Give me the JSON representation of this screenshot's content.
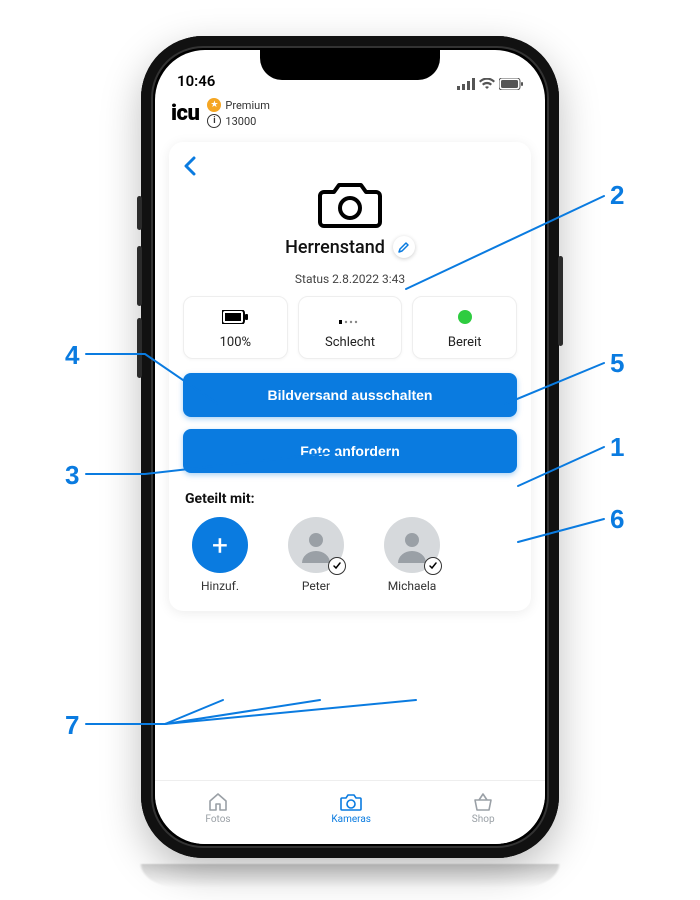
{
  "status_bar": {
    "time": "10:46"
  },
  "header": {
    "logo": "icu",
    "premium_label": "Premium",
    "points": "13000"
  },
  "camera": {
    "name": "Herrenstand",
    "status_line": "Status 2.8.2022 3:43",
    "tiles": {
      "battery": "100%",
      "signal": "Schlecht",
      "ready": "Bereit"
    },
    "btn_disable": "Bildversand ausschalten",
    "btn_request": "Foto anfordern",
    "shared_title": "Geteilt mit:",
    "shared": {
      "add": "Hinzuf.",
      "u1": "Peter",
      "u2": "Michaela"
    }
  },
  "tabs": {
    "photos": "Fotos",
    "cameras": "Kameras",
    "shop": "Shop"
  },
  "callouts": {
    "c1": "1",
    "c2": "2",
    "c3": "3",
    "c4": "4",
    "c5": "5",
    "c6": "6",
    "c7": "7"
  }
}
